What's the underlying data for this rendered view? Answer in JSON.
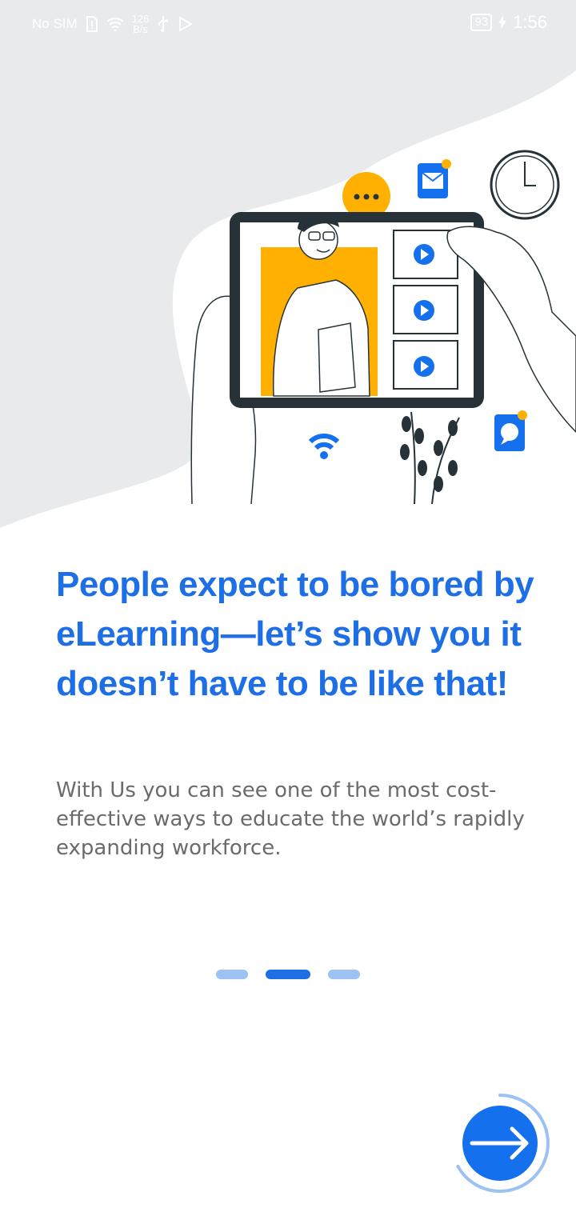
{
  "status_bar": {
    "carrier": "No SIM",
    "net_speed_value": "126",
    "net_speed_unit": "B/s",
    "battery": "93",
    "time": "1:56",
    "icons": [
      "sim-alert-icon",
      "wifi-icon",
      "usb-icon",
      "play-store-icon",
      "charging-icon"
    ]
  },
  "onboarding": {
    "headline": "People expect to be bored by eLearning—let’s show you it doesn’t have to be like that!",
    "body": "With Us you can see one of the most cost-effective ways to educate the world’s rapidly expanding workforce.",
    "page_count": 3,
    "current_page": 2,
    "progress_fraction": 0.67
  },
  "colors": {
    "accent": "#1e6fe6",
    "illustration_yellow": "#ffb000",
    "illustration_dark": "#263238",
    "background_blob": "#e9eaec"
  }
}
